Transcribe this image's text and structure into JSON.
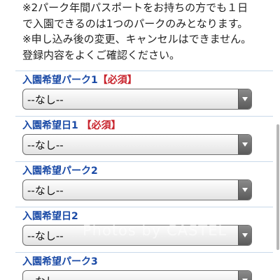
{
  "notice": {
    "line1": "※2パーク年間パスポートをお持ちの方でも１日",
    "line2": "で入園できるのは1つのパークのみとなります。",
    "line3": "※申し込み後の変更、キャンセルはできません。",
    "line4": "登録内容をよくご確認ください。"
  },
  "fields": [
    {
      "label": "入園希望パーク1",
      "required": "【必須】",
      "value": "--なし--"
    },
    {
      "label": "入園希望日1",
      "required": "【必須】",
      "value": "--なし--"
    },
    {
      "label": "入園希望パーク2",
      "required": "",
      "value": "--なし--"
    },
    {
      "label": "入園希望日2",
      "required": "",
      "value": "--なし--"
    },
    {
      "label": "入園希望パーク3",
      "required": "",
      "value": "--なし--"
    }
  ],
  "watermark": "Photos by CASTEL"
}
